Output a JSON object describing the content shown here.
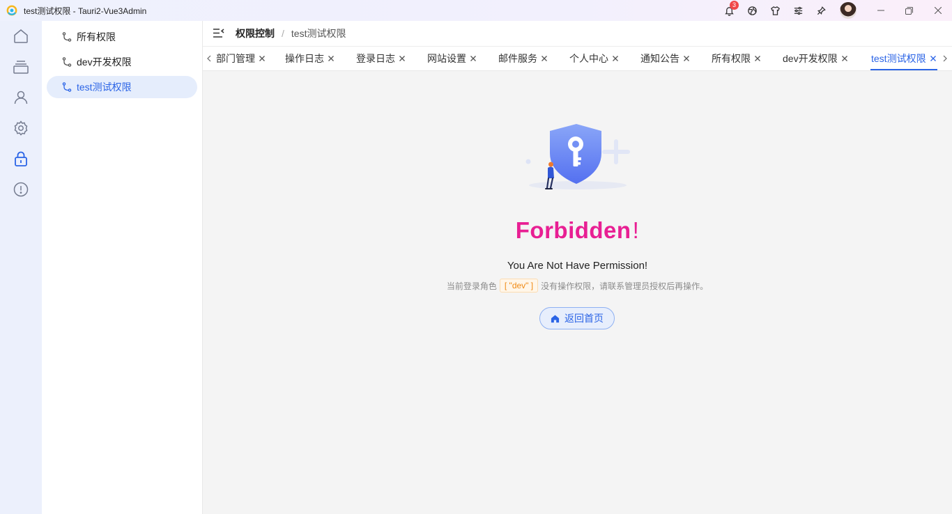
{
  "window": {
    "title": "test测试权限 - Tauri2-Vue3Admin",
    "notification_count": "3"
  },
  "rail": {
    "items": [
      {
        "icon": "home-icon"
      },
      {
        "icon": "layers-icon"
      },
      {
        "icon": "user-icon"
      },
      {
        "icon": "settings-icon"
      },
      {
        "icon": "lock-icon",
        "active": true
      },
      {
        "icon": "alert-circle-icon"
      }
    ]
  },
  "submenu": {
    "items": [
      {
        "label": "所有权限"
      },
      {
        "label": "dev开发权限"
      },
      {
        "label": "test测试权限",
        "active": true
      }
    ]
  },
  "breadcrumb": {
    "parent": "权限控制",
    "separator": "/",
    "current": "test测试权限"
  },
  "tabs": [
    {
      "label": "部门管理"
    },
    {
      "label": "操作日志"
    },
    {
      "label": "登录日志"
    },
    {
      "label": "网站设置"
    },
    {
      "label": "邮件服务"
    },
    {
      "label": "个人中心"
    },
    {
      "label": "通知公告"
    },
    {
      "label": "所有权限"
    },
    {
      "label": "dev开发权限"
    },
    {
      "label": "test测试权限",
      "active": true
    }
  ],
  "content": {
    "title": "Forbidden",
    "title_mark": "!",
    "subtitle": "You Are Not Have Permission!",
    "desc_prefix": "当前登录角色",
    "role": "[ \"dev\" ]",
    "desc_suffix": "没有操作权限，请联系管理员授权后再操作。",
    "home_button": "返回首页"
  },
  "colors": {
    "accent": "#2b64e6",
    "forbidden": "#e81f93",
    "role_tag": "#f08a14"
  }
}
